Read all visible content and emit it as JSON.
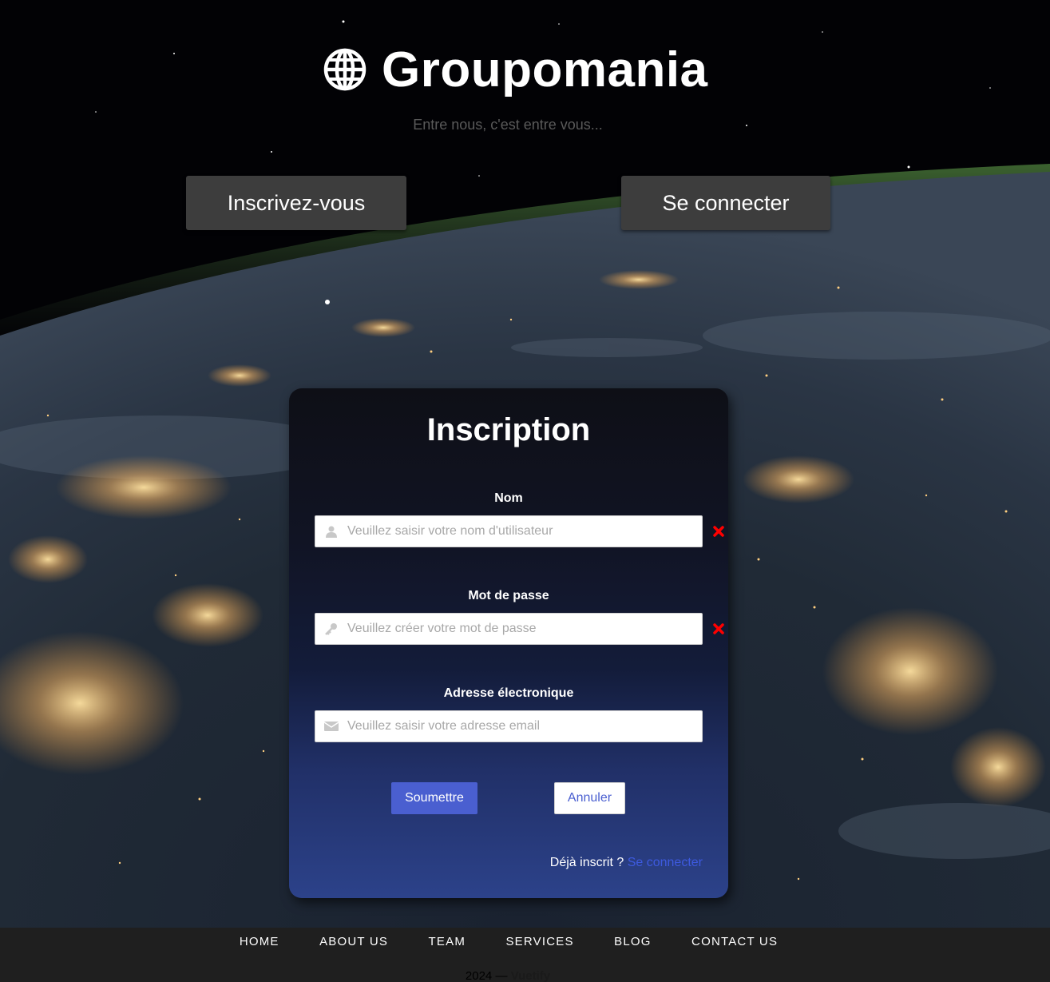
{
  "brand": {
    "name": "Groupomania",
    "tagline": "Entre nous, c'est entre vous..."
  },
  "top_buttons": {
    "signup": "Inscrivez-vous",
    "login": "Se connecter"
  },
  "form": {
    "title": "Inscription",
    "fields": [
      {
        "label": "Nom",
        "placeholder": "Veuillez saisir votre nom d'utilisateur",
        "icon": "user-icon",
        "error": true
      },
      {
        "label": "Mot de passe",
        "placeholder": "Veuillez créer votre mot de passe",
        "icon": "key-icon",
        "error": true
      },
      {
        "label": "Adresse électronique",
        "placeholder": "Veuillez saisir votre adresse email",
        "icon": "envelope-icon",
        "error": false
      }
    ],
    "submit_label": "Soumettre",
    "cancel_label": "Annuler",
    "already_text": "Déjà inscrit ?",
    "login_link": "Se connecter"
  },
  "footer": {
    "nav": [
      "HOME",
      "ABOUT US",
      "TEAM",
      "SERVICES",
      "BLOG",
      "CONTACT US"
    ],
    "year": "2024 —",
    "credit": "Vuetify"
  },
  "colors": {
    "primary": "#4a5fd0",
    "error": "#ff0000",
    "button_dark": "#3d3d3d",
    "footer_bg": "#1f1f1f"
  }
}
